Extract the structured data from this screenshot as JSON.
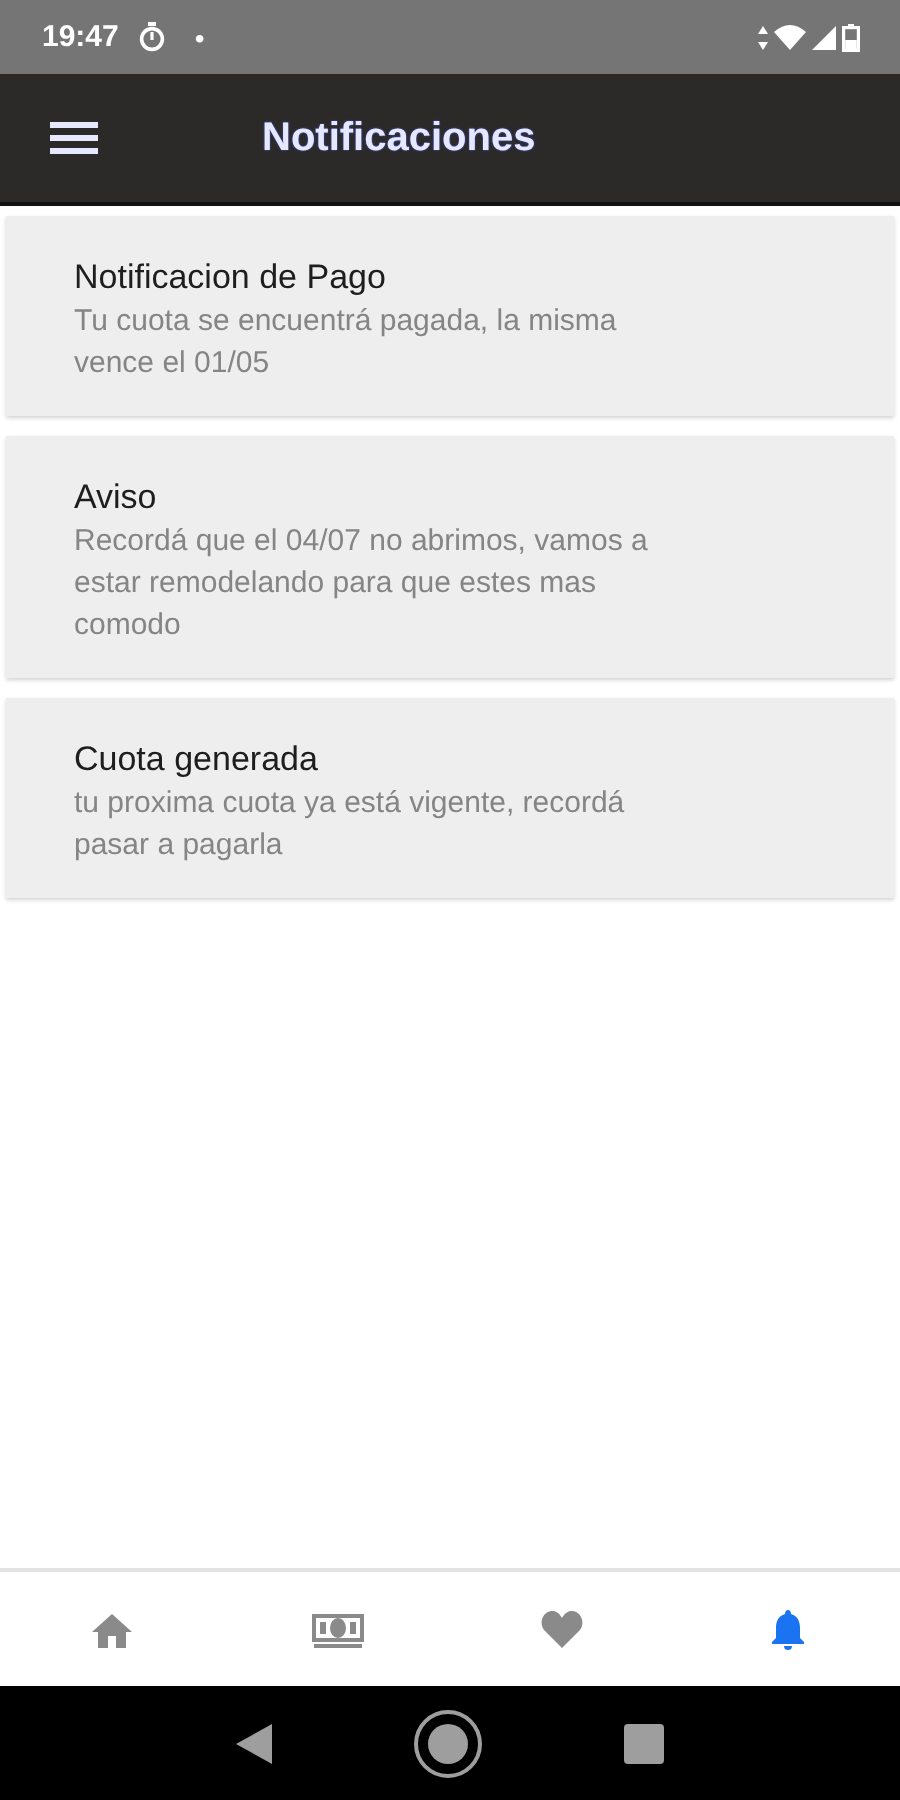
{
  "status_bar": {
    "time": "19:47",
    "dot": "•"
  },
  "app_bar": {
    "title": "Notificaciones"
  },
  "notifications": [
    {
      "title": "Notificacion de Pago",
      "body": "Tu cuota se encuentrá pagada, la misma vence el 01/05"
    },
    {
      "title": "Aviso",
      "body": "Recordá que el 04/07 no abrimos, vamos a estar remodelando para que estes mas comodo"
    },
    {
      "title": "Cuota generada",
      "body": "tu proxima cuota ya está vigente, recordá pasar a pagarla"
    }
  ],
  "bottom_nav": [
    {
      "kind": "home",
      "selected": false
    },
    {
      "kind": "money",
      "selected": false
    },
    {
      "kind": "heart",
      "selected": false
    },
    {
      "kind": "bell",
      "selected": true
    }
  ]
}
